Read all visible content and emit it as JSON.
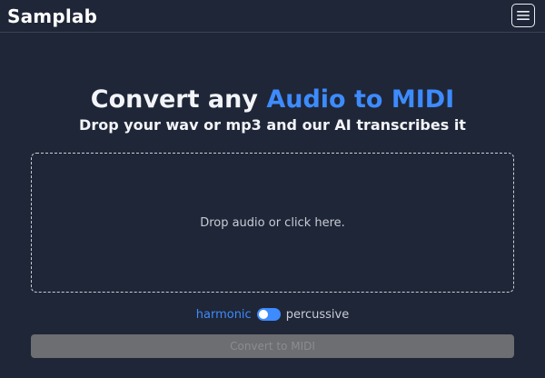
{
  "navbar": {
    "brand": "Samplab",
    "menu_icon": "hamburger-menu-icon"
  },
  "hero": {
    "title_prefix": "Convert any ",
    "title_accent": "Audio to MIDI",
    "subtitle": "Drop your wav or mp3 and our AI transcribes it"
  },
  "dropzone": {
    "text": "Drop audio or click here."
  },
  "mode": {
    "left_label": "harmonic",
    "right_label": "percussive",
    "selected": "harmonic"
  },
  "convert": {
    "label": "Convert to MIDI",
    "disabled": true
  },
  "colors": {
    "background": "#1f2637",
    "accent": "#3d8bfd",
    "button_disabled": "#6d6e71"
  }
}
